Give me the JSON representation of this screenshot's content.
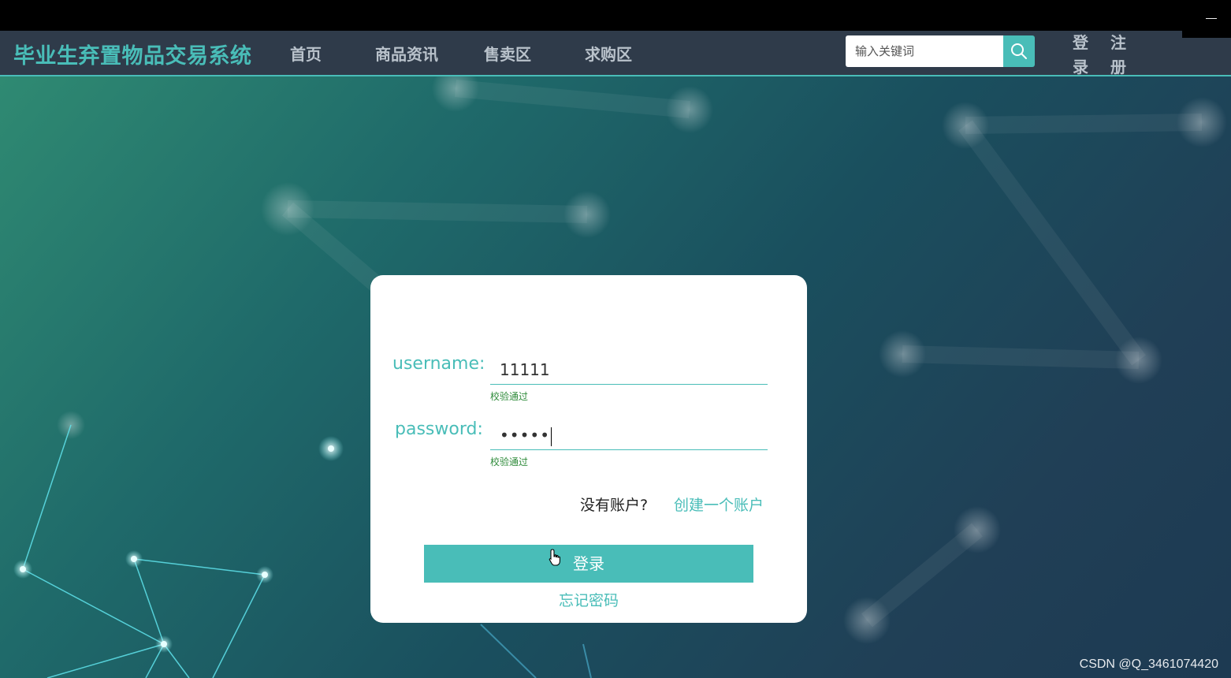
{
  "window": {
    "minimize_glyph": "—"
  },
  "navbar": {
    "brand": "毕业生弃置物品交易系统",
    "links": [
      "首页",
      "商品资讯",
      "售卖区",
      "求购区"
    ],
    "search": {
      "placeholder": "输入关键词",
      "button_icon": "search-icon"
    },
    "login_label": "登录",
    "register_label": "注册"
  },
  "login_form": {
    "username": {
      "label": "username:",
      "value": "11111",
      "validation": "校验通过"
    },
    "password": {
      "label": "password:",
      "masked_value": "•••••",
      "validation": "校验通过"
    },
    "no_account_text": "没有账户?",
    "create_account_link": "创建一个账户",
    "submit_label": "登录",
    "forgot_password_link": "忘记密码"
  },
  "watermark": "CSDN @Q_3461074420",
  "colors": {
    "accent": "#49bdb8",
    "navbar_bg": "#2f3b4a",
    "nav_text": "#b9c2cb",
    "validation_ok": "#2e8b3a"
  }
}
